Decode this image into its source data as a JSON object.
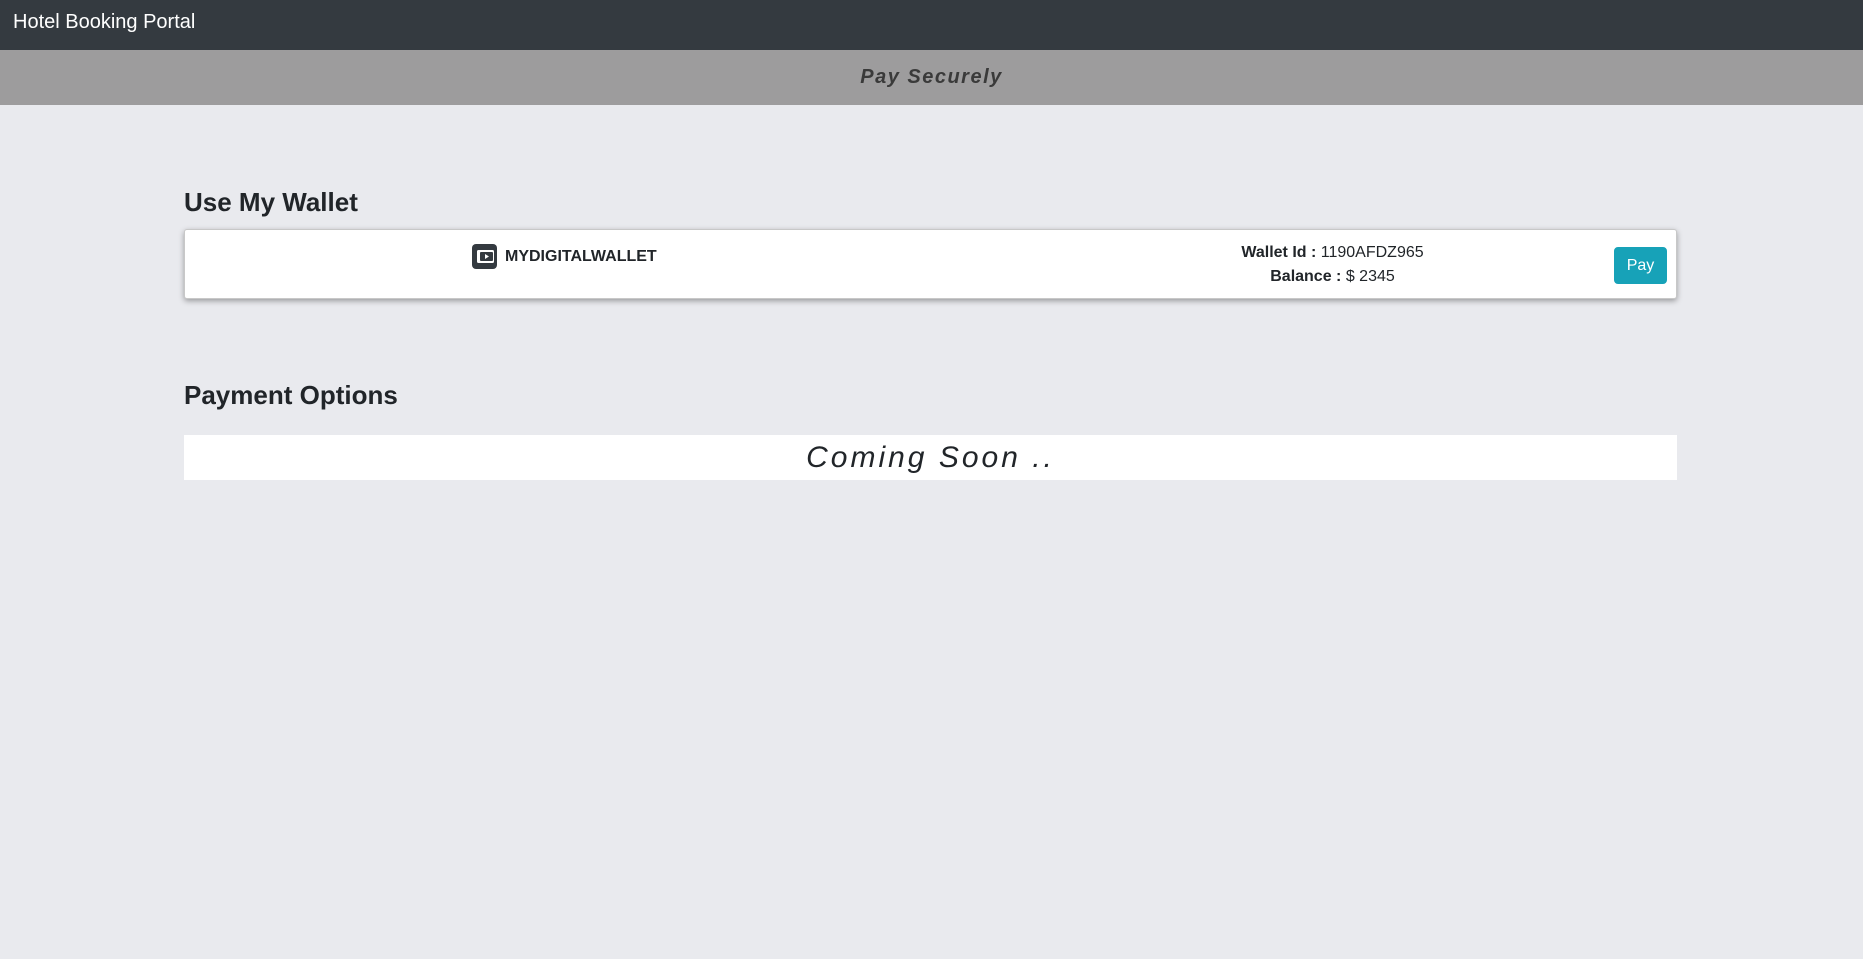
{
  "navbar": {
    "brand": "Hotel Booking Portal"
  },
  "subheader": {
    "title": "Pay Securely"
  },
  "wallet_section": {
    "title": "Use My Wallet",
    "wallet": {
      "icon": "wallet-icon",
      "name": "MYDIGITALWALLET",
      "id_label": "Wallet Id :",
      "id_value": "1190AFDZ965",
      "balance_label": "Balance :",
      "balance_value": "$ 2345",
      "pay_label": "Pay"
    }
  },
  "payment_section": {
    "title": "Payment Options",
    "message": "Coming Soon .."
  },
  "colors": {
    "navbar": "#343a40",
    "subheader": "#9d9c9d",
    "background": "#e9eaee",
    "pay_button": "#17a2b8"
  }
}
